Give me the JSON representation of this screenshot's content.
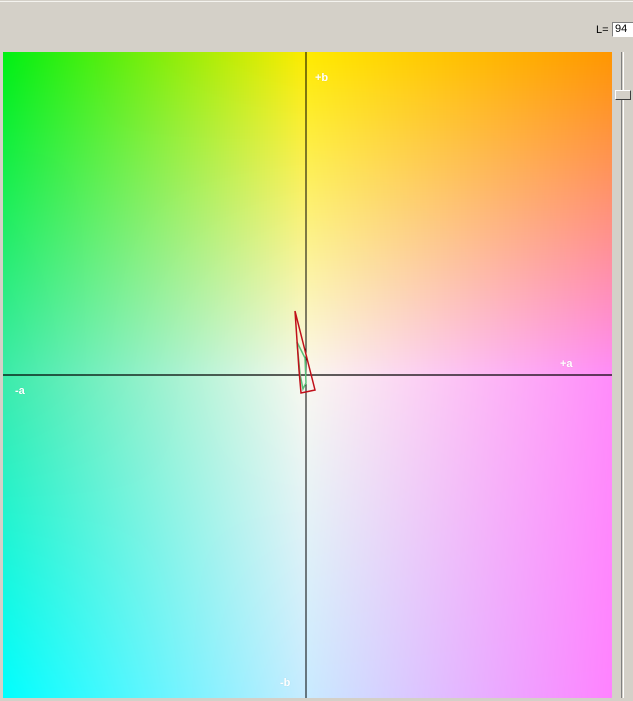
{
  "lightness": {
    "label": "L=",
    "value": "94",
    "slider_fraction": 0.06
  },
  "plot": {
    "axis_labels": {
      "pos_b": "+b",
      "neg_b": "-b",
      "pos_a": "+a",
      "neg_a": "-a"
    },
    "colors": {
      "axis_line": "#000000",
      "gamut_outer": "#c0101a",
      "gamut_inner": "#5bbf7a"
    }
  }
}
